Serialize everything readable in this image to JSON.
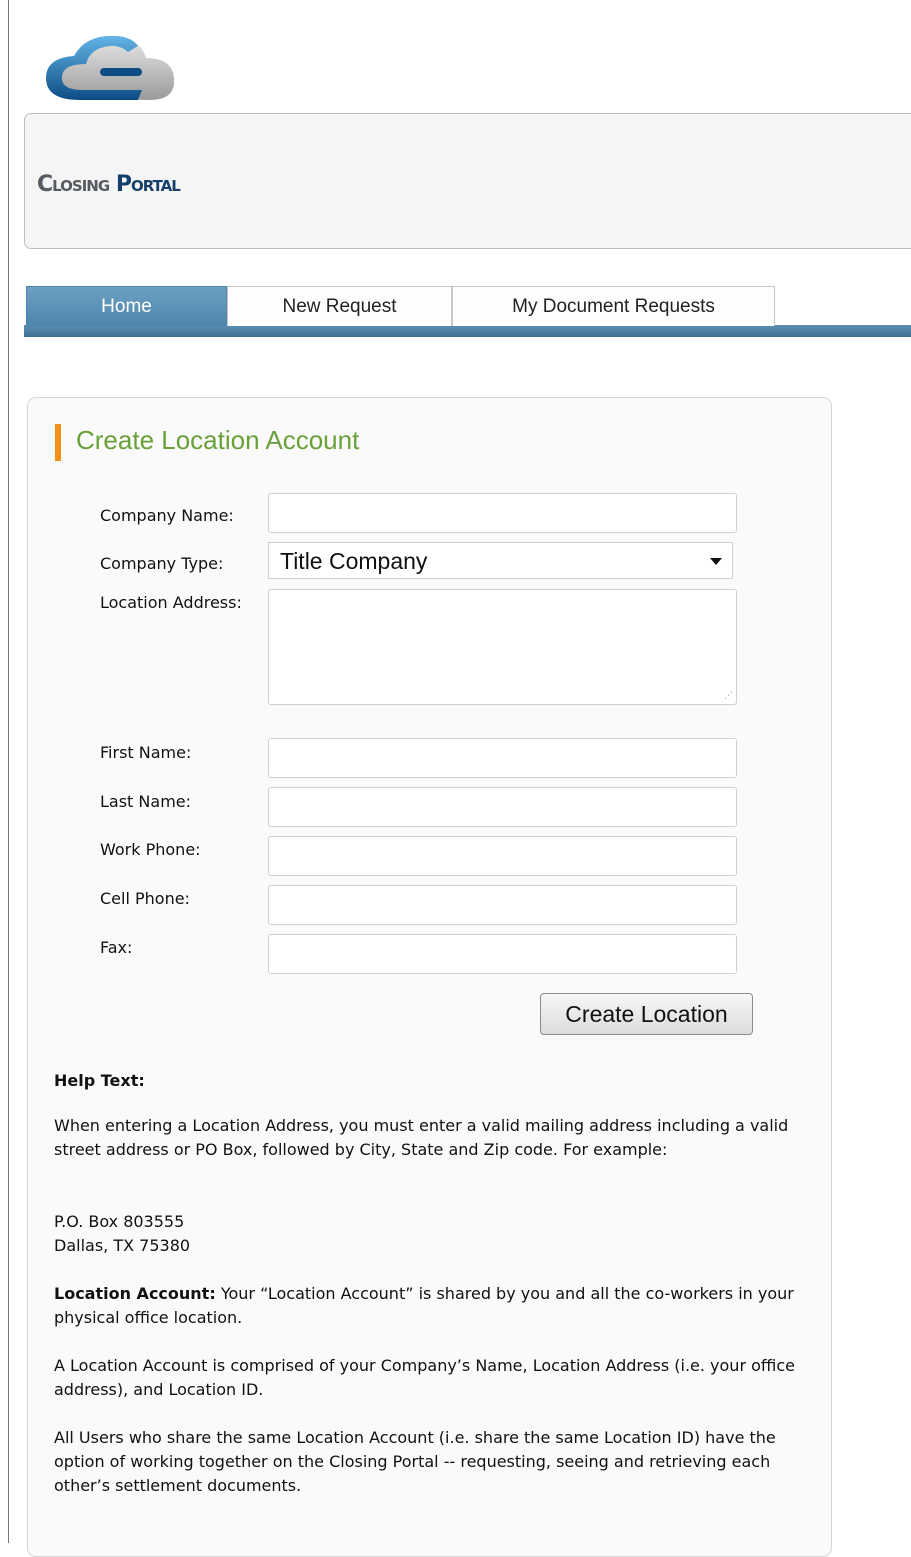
{
  "header": {
    "brand_part1": "Closing",
    "brand_part2": "Portal"
  },
  "nav": {
    "tabs": [
      "Home",
      "New Request",
      "My Document Requests"
    ],
    "active": "Home"
  },
  "form": {
    "title": "Create Location Account",
    "company_name_label": "Company Name:",
    "company_name_value": "",
    "company_type_label": "Company Type:",
    "company_type_value": "Title Company",
    "location_address_label": "Location Address:",
    "location_address_value": "",
    "first_name_label": "First Name:",
    "first_name_value": "",
    "last_name_label": "Last Name:",
    "last_name_value": "",
    "work_phone_label": "Work Phone:",
    "work_phone_value": "",
    "cell_phone_label": "Cell Phone:",
    "cell_phone_value": "",
    "fax_label": "Fax:",
    "fax_value": "",
    "submit_label": "Create Location"
  },
  "help": {
    "heading": "Help Text:",
    "para1": "When entering a Location Address, you must enter a valid mailing address including a valid street address or PO Box, followed by City, State and Zip code. For example:",
    "example_line1": "P.O. Box 803555",
    "example_line2": "Dallas, TX 75380",
    "para2_bold": "Location Account:",
    "para2_rest": " Your “Location Account” is shared by you and all the co-workers in your physical office location.",
    "para3": "A Location Account is comprised of your Company’s Name, Location Address (i.e. your office address), and Location ID.",
    "para4": "All Users who share the same Location Account (i.e. share the same Location ID) have the option of working together on the Closing Portal -- requesting, seeing and retrieving each other’s settlement documents."
  },
  "colors": {
    "accent_orange": "#f3901d",
    "title_green": "#6aa03a",
    "nav_blue": "#4d86ab"
  }
}
